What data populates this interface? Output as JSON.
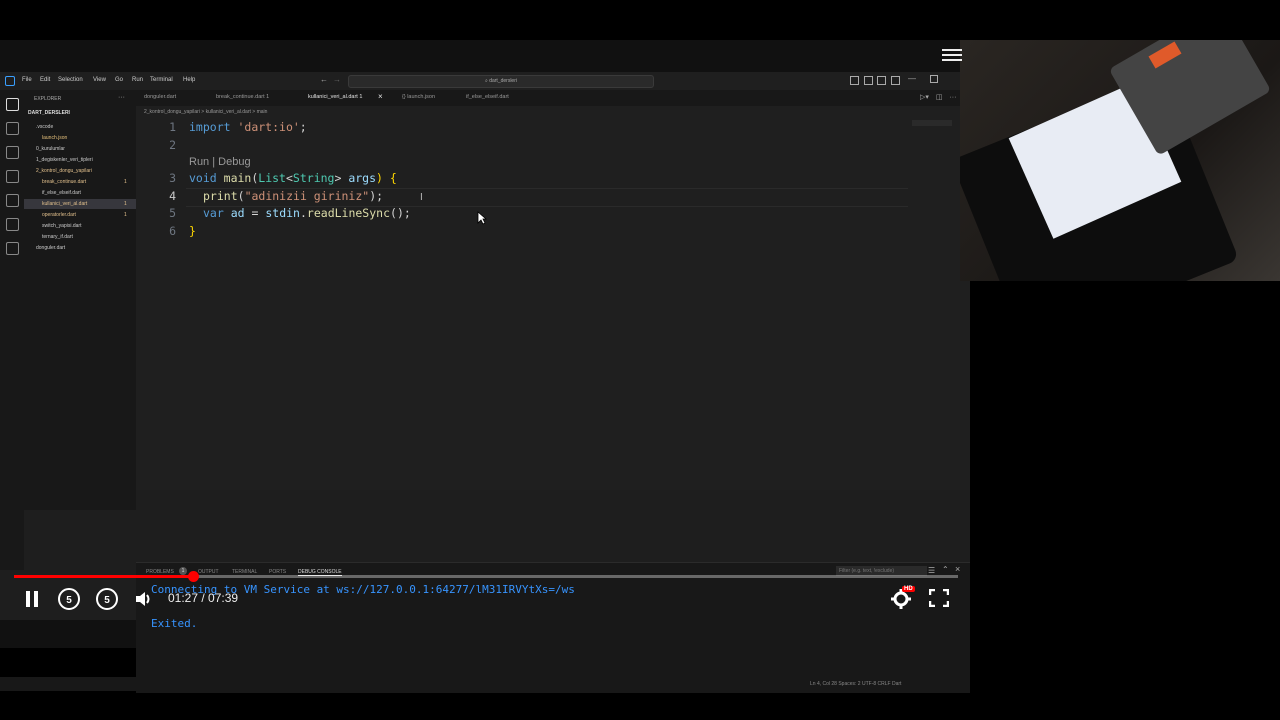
{
  "titlebar": {
    "menus": [
      "File",
      "Edit",
      "Selection",
      "View",
      "Go",
      "Run",
      "Terminal",
      "Help"
    ],
    "search_text": "dart_dersleri"
  },
  "sidebar": {
    "header": "EXPLORER",
    "root": "DART_DERSLERI",
    "items": [
      {
        "label": ".vscode",
        "color": "#cccccc",
        "indent": 1
      },
      {
        "label": "launch.json",
        "color": "#e5c07b",
        "indent": 2
      },
      {
        "label": "0_kurulumlar",
        "color": "#cccccc",
        "indent": 1
      },
      {
        "label": "1_degiskenler_veri_tipleri",
        "color": "#cccccc",
        "indent": 1
      },
      {
        "label": "2_kontrol_dongu_yapilari",
        "color": "#e2c08d",
        "indent": 1
      },
      {
        "label": "break_continue.dart",
        "color": "#e2c08d",
        "indent": 2,
        "badge": "1"
      },
      {
        "label": "if_else_elseif.dart",
        "color": "#cccccc",
        "indent": 2
      },
      {
        "label": "kullanici_veri_al.dart",
        "color": "#e2c08d",
        "indent": 2,
        "badge": "1",
        "selected": true
      },
      {
        "label": "operatorler.dart",
        "color": "#e2c08d",
        "indent": 2,
        "badge": "1"
      },
      {
        "label": "switch_yapisi.dart",
        "color": "#cccccc",
        "indent": 2
      },
      {
        "label": "ternary_if.dart",
        "color": "#cccccc",
        "indent": 2
      },
      {
        "label": "donguler.dart",
        "color": "#cccccc",
        "indent": 1
      }
    ]
  },
  "editor": {
    "tabs": [
      {
        "label": "donguler.dart",
        "active": false
      },
      {
        "label": "break_continue.dart 1",
        "active": false
      },
      {
        "label": "kullanici_veri_al.dart 1",
        "active": true
      },
      {
        "label": "{} launch.json",
        "active": false
      },
      {
        "label": "if_else_elseif.dart",
        "active": false
      }
    ],
    "breadcrumb": "2_kontrol_dongu_yapilari > kullanici_veri_al.dart > main",
    "codelens": "Run | Debug",
    "line_numbers": [
      "1",
      "2",
      "3",
      "4",
      "5",
      "6"
    ],
    "code": {
      "l1_kw": "import",
      "l1_str": "'dart:io'",
      "l1_end": ";",
      "l3_kw": "void",
      "l3_fn": "main",
      "l3_p1": "(",
      "l3_typ1": "List",
      "l3_lt": "<",
      "l3_typ2": "String",
      "l3_gt": "> ",
      "l3_var": "args",
      "l3_end": ") {",
      "l4_fn": "print",
      "l4_p": "(",
      "l4_str": "\"adinizii giriniz\"",
      "l4_end": ");",
      "l5_kw": "var",
      "l5_var": "ad",
      "l5_eq": " = ",
      "l5_obj": "stdin",
      "l5_dot": ".",
      "l5_fn": "readLineSync",
      "l5_end": "();",
      "l6": "}"
    }
  },
  "panel": {
    "tabs": [
      "PROBLEMS",
      "OUTPUT",
      "TERMINAL",
      "PORTS",
      "DEBUG CONSOLE"
    ],
    "problems_count": "1",
    "filter_placeholder": "Filter (e.g. text, !exclude)",
    "lines": [
      "Connecting to VM Service at ws://127.0.0.1:64277/lM31IRVYtXs=/ws",
      "Exited."
    ]
  },
  "player": {
    "current_time": "01:27",
    "duration": "07:39",
    "time_display": "01:27 / 07:39",
    "progress": 0.19,
    "quality_badge": "HD",
    "skip_seconds": "5",
    "accent": "#ff0000"
  },
  "statusbar": {
    "right": "Ln 4, Col 28   Spaces: 2   UTF-8   CRLF   Dart"
  }
}
